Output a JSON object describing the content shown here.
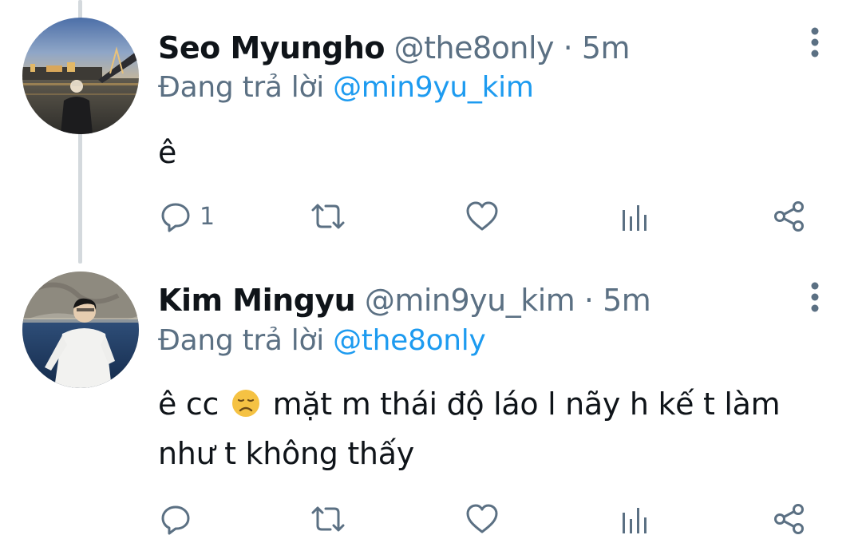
{
  "tweets": [
    {
      "name": "Seo Myungho",
      "handle": "@the8only",
      "separator": "·",
      "time": "5m",
      "reply_prefix": "Đang trả lời",
      "reply_to": "@min9yu_kim",
      "text": "ê",
      "reply_count": "1"
    },
    {
      "name": "Kim Mingyu",
      "handle": "@min9yu_kim",
      "separator": "·",
      "time": "5m",
      "reply_prefix": "Đang trả lời",
      "reply_to": "@the8only",
      "text_before_emoji": "ê cc",
      "emoji": "disappointed-face",
      "text_after_emoji": "mặt m thái độ láo l nãy h kế t làm như t không thấy",
      "reply_count": ""
    }
  ],
  "icons": {
    "reply": "reply-icon",
    "retweet": "retweet-icon",
    "like": "like-icon",
    "analytics": "analytics-icon",
    "share": "share-icon",
    "more": "more-options-icon"
  },
  "colors": {
    "text": "#0f1419",
    "secondary": "#5b7083",
    "link": "#1d9bf0",
    "thread_line": "#d4d9dd"
  }
}
